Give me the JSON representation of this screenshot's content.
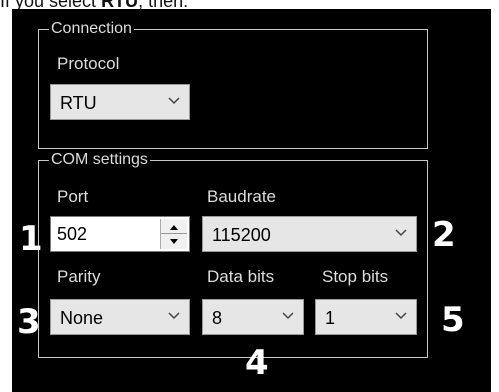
{
  "doc": {
    "prefix": "If you select ",
    "bold": "RTU",
    "suffix": ", then:"
  },
  "connection": {
    "title": "Connection",
    "protocol_label": "Protocol",
    "protocol_value": "RTU"
  },
  "com_settings": {
    "title": "COM settings",
    "port_label": "Port",
    "port_value": "502",
    "baudrate_label": "Baudrate",
    "baudrate_value": "115200",
    "parity_label": "Parity",
    "parity_value": "None",
    "data_bits_label": "Data bits",
    "data_bits_value": "8",
    "stop_bits_label": "Stop bits",
    "stop_bits_value": "1"
  },
  "callouts": [
    "1",
    "2",
    "3",
    "4",
    "5"
  ],
  "icons": {
    "dropdown": "chevron-down-icon",
    "spin_up": "arrow-up-icon",
    "spin_down": "arrow-down-icon"
  },
  "colors": {
    "panel_bg": "#000000",
    "label_text": "#dcdcdc",
    "control_bg": "#e6e6e6",
    "callout_text": "#ffffff"
  }
}
